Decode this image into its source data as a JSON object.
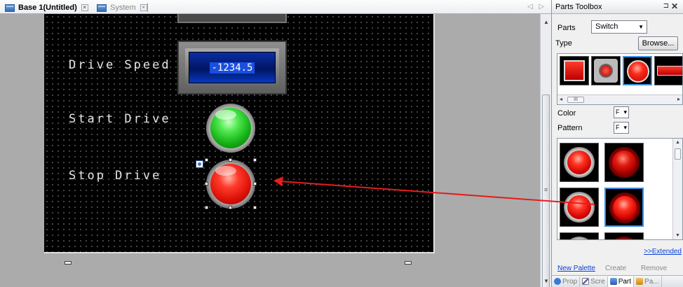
{
  "tabs": [
    {
      "label": "Base 1(Untitled)",
      "close": "×"
    },
    {
      "label": "System",
      "close": "×"
    }
  ],
  "tab_nav": "◁ ▷",
  "screen": {
    "labels": {
      "drive_speed": "Drive Speed",
      "start_drive": "Start Drive",
      "stop_drive": "Stop Drive"
    },
    "numeric_display_value": "-1234.5"
  },
  "toolbox": {
    "title": "Parts Toolbox",
    "pin": "⊐",
    "close": "✕",
    "parts_label": "Parts",
    "parts_value": "Switch",
    "type_label": "Type",
    "browse_label": "Browse...",
    "hscroll_left": "◂",
    "hscroll_right": "▸",
    "hscroll_grip": "III",
    "color_label": "Color",
    "color_value": "F",
    "pattern_label": "Pattern",
    "pattern_value": "F",
    "pattern_scroll_up": "▲",
    "pattern_scroll_down": "▼",
    "extended_link": ">>Extended",
    "new_palette": "New Palette",
    "create": "Create",
    "remove": "Remove",
    "bottom_tabs": [
      "Prop",
      "Scre",
      "Part",
      "Pa..."
    ]
  },
  "colors": {
    "accent_selection": "#3d8ee8",
    "arrow": "#e81c1c",
    "lcd_blue": "#021560",
    "link_blue": "#0a3fd6"
  }
}
